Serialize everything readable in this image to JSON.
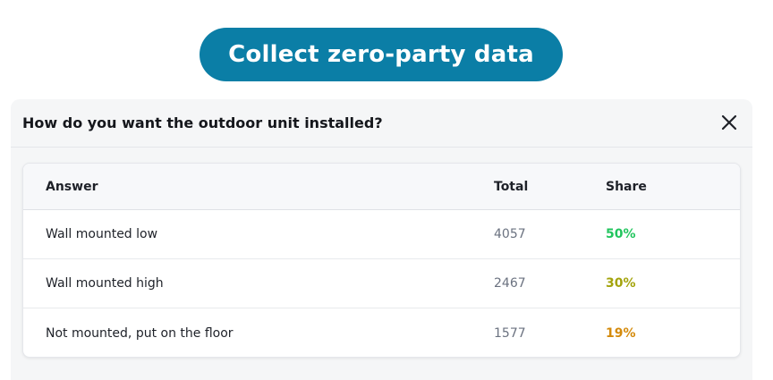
{
  "banner": {
    "label": "Collect zero-party data"
  },
  "panel": {
    "question": "How do you want the outdoor unit installed?",
    "close_icon": "close-icon"
  },
  "table": {
    "headers": {
      "answer": "Answer",
      "total": "Total",
      "share": "Share"
    },
    "rows": [
      {
        "answer": "Wall mounted low",
        "total": "4057",
        "share": "50%",
        "share_color": "#22c55e"
      },
      {
        "answer": "Wall mounted high",
        "total": "2467",
        "share": "30%",
        "share_color": "#a3a30b"
      },
      {
        "answer": "Not mounted, put on the floor",
        "total": "1577",
        "share": "19%",
        "share_color": "#d48a0b"
      }
    ]
  },
  "colors": {
    "banner_bg": "#0b7ea6",
    "panel_bg": "#f5f6f7"
  }
}
